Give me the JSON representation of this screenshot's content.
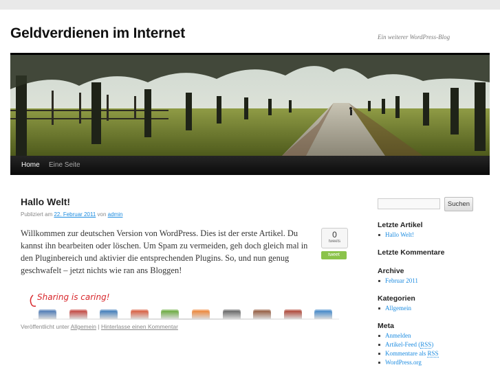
{
  "site": {
    "title": "Geldverdienen im Internet",
    "description": "Ein weiterer WordPress-Blog"
  },
  "nav": {
    "items": [
      {
        "label": "Home",
        "current": true
      },
      {
        "label": "Eine Seite",
        "current": false
      }
    ]
  },
  "post": {
    "title": "Hallo Welt!",
    "meta": {
      "published_prefix": "Publiziert am",
      "date": "22. Februar 2011",
      "by": "von",
      "author": "admin"
    },
    "body": "Willkommen zur deutschen Version von WordPress. Dies ist der erste Artikel. Du kannst ihn bearbeiten oder löschen. Um Spam zu vermeiden, geh doch gleich mal in den Pluginbereich und aktivier die entsprechenden Plugins. So, und nun genug geschwafelt – jetzt nichts wie ran ans Bloggen!",
    "tweet": {
      "count": "0",
      "count_label": "tweets",
      "button": "tweet"
    },
    "sharing_label": "Sharing is caring!",
    "share_icons": [
      {
        "name": "delicious-icon",
        "color": "#3a6db0"
      },
      {
        "name": "digg-icon",
        "color": "#c0322b"
      },
      {
        "name": "stumbleupon-icon",
        "color": "#2a6fb5"
      },
      {
        "name": "reddit-icon",
        "color": "#d84b2a"
      },
      {
        "name": "technorati-icon",
        "color": "#5aa328"
      },
      {
        "name": "blogger-icon",
        "color": "#f07a22"
      },
      {
        "name": "youtube-icon",
        "color": "#555555"
      },
      {
        "name": "myspace-icon",
        "color": "#8a4a2a"
      },
      {
        "name": "posterous-icon",
        "color": "#a8301f"
      },
      {
        "name": "bookmark-icon",
        "color": "#2d7cc6"
      }
    ],
    "footer": {
      "prefix": "Veröffentlicht unter",
      "category": "Allgemein",
      "separator": "|",
      "comment_link": "Hinterlasse einen Kommentar"
    }
  },
  "sidebar": {
    "search": {
      "placeholder": "",
      "button": "Suchen"
    },
    "recent_posts": {
      "title": "Letzte Artikel",
      "items": [
        "Hallo Welt!"
      ]
    },
    "recent_comments": {
      "title": "Letzte Kommentare"
    },
    "archive": {
      "title": "Archive",
      "items": [
        "Februar 2011"
      ]
    },
    "categories": {
      "title": "Kategorien",
      "items": [
        "Allgemein"
      ]
    },
    "meta": {
      "title": "Meta",
      "items": [
        {
          "text": "Anmelden"
        },
        {
          "text": "Artikel-Feed",
          "abbr": "RSS"
        },
        {
          "text": "Kommentare als",
          "abbr": "RSS"
        },
        {
          "text": "WordPress.org"
        }
      ]
    }
  },
  "colors": {
    "link": "#1b8be0",
    "menu_bg": "#1a1a1a",
    "tweet_green": "#8bc34a"
  }
}
